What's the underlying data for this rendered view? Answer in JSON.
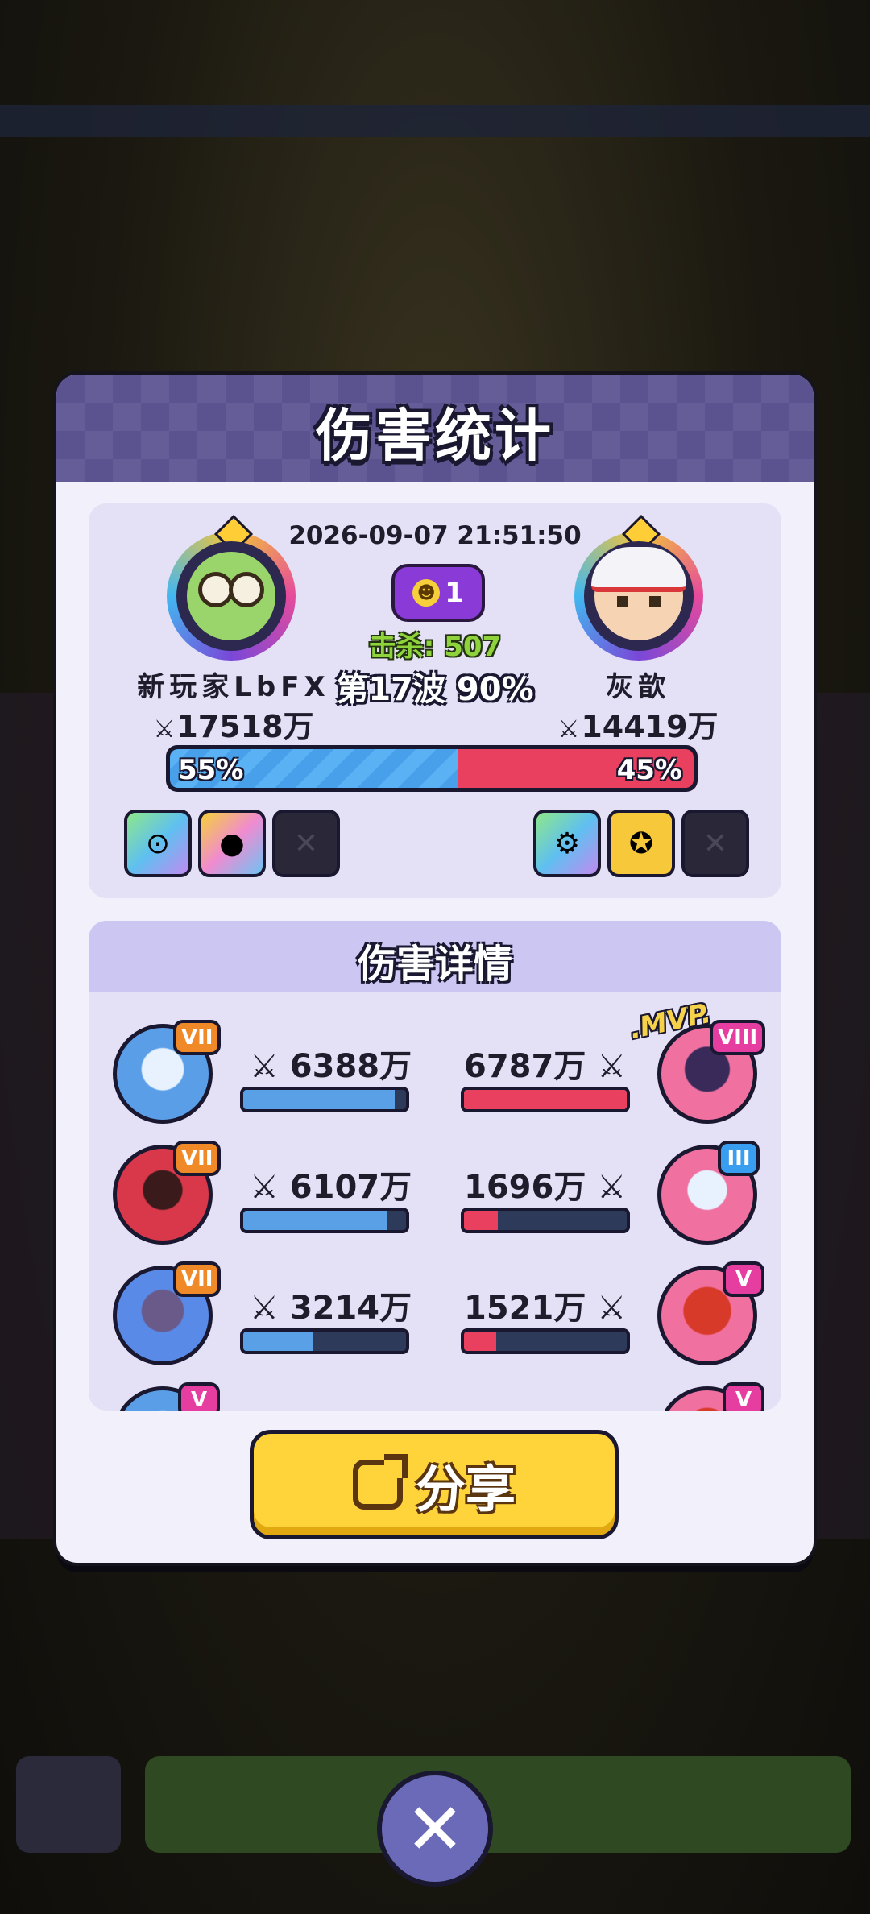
{
  "dialog": {
    "title": "伤害统计",
    "date": "2026-09-07 21:51:50",
    "player_left": {
      "name": "新玩家LbFX",
      "power": "17518万"
    },
    "player_right": {
      "name": "灰歆",
      "power": "14419万"
    },
    "kill_badge": "1",
    "kills_text": "击杀: 507",
    "wave_text": "第17波 90%",
    "ratio": {
      "left_label": "55%",
      "right_label": "45%",
      "left_fraction": 0.55
    },
    "left_slots": [
      "item-icon",
      "cat-icon",
      "empty-slot"
    ],
    "right_slots": [
      "gear-icon",
      "target-icon",
      "empty-slot"
    ]
  },
  "details": {
    "title": "伤害详情",
    "rows": [
      {
        "left_rank": "VII",
        "left_damage": "6388万",
        "left_fill": 0.93,
        "right_damage": "6787万",
        "right_fill": 1.0,
        "right_rank": "VIII",
        "mvp": ".MVP."
      },
      {
        "left_rank": "VII",
        "left_damage": "6107万",
        "left_fill": 0.88,
        "right_damage": "1696万",
        "right_fill": 0.21,
        "right_rank": "III"
      },
      {
        "left_rank": "VII",
        "left_damage": "3214万",
        "left_fill": 0.43,
        "right_damage": "1521万",
        "right_fill": 0.2,
        "right_rank": "V"
      },
      {
        "left_rank": "V",
        "right_rank": "V"
      }
    ]
  },
  "share_label": "分享",
  "close_label": "✕",
  "power_icon_char": "⚔",
  "colors": {
    "accent_blue": "#5ab2f4",
    "accent_red": "#e8405e",
    "button_yellow": "#ffd43a",
    "header_purple": "#5a5390"
  }
}
